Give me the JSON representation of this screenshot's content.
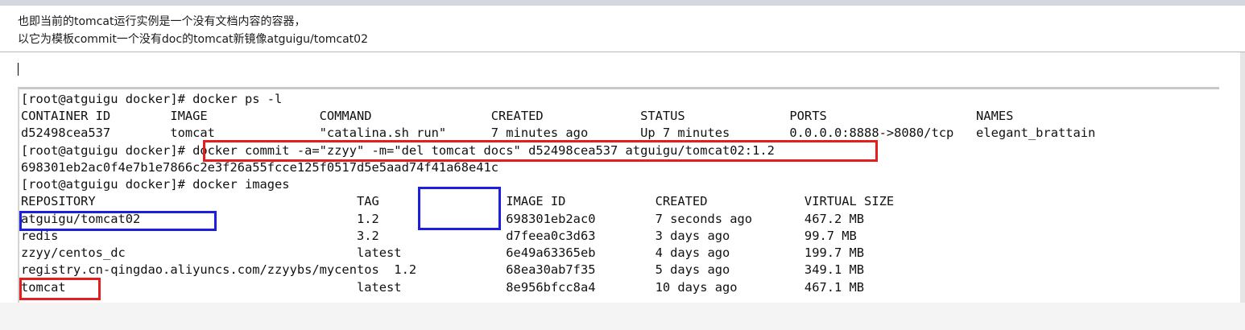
{
  "notes": {
    "line1": "也即当前的tomcat运行实例是一个没有文档内容的容器，",
    "line2": "以它为模板commit一个没有doc的tomcat新镜像atguigu/tomcat02"
  },
  "terminal": {
    "lines": [
      "[root@atguigu docker]# docker ps -l",
      "CONTAINER ID        IMAGE               COMMAND                CREATED             STATUS              PORTS                    NAMES",
      "d52498cea537        tomcat              \"catalina.sh run\"      7 minutes ago       Up 7 minutes        0.0.0.0:8888->8080/tcp   elegant_brattain",
      "[root@atguigu docker]# docker commit -a=\"zzyy\" -m=\"del tomcat docs\" d52498cea537 atguigu/tomcat02:1.2",
      "698301eb2ac0f4e7b1e7866c2e3f26a55fcce125f0517d5e5aad74f41a68e41c",
      "[root@atguigu docker]# docker images",
      "REPOSITORY                                   TAG                 IMAGE ID            CREATED             VIRTUAL SIZE",
      "atguigu/tomcat02                             1.2                 698301eb2ac0        7 seconds ago       467.2 MB",
      "redis                                        3.2                 d7feea0c3d63        3 days ago          99.7 MB",
      "zzyy/centos_dc                               latest              6e49a63365eb        4 days ago          199.7 MB",
      "registry.cn-qingdao.aliyuncs.com/zzyybs/mycentos  1.2            68ea30ab7f35        5 days ago          349.1 MB",
      "tomcat                                       latest              8e956bfcc8a4        10 days ago         467.1 MB"
    ]
  }
}
